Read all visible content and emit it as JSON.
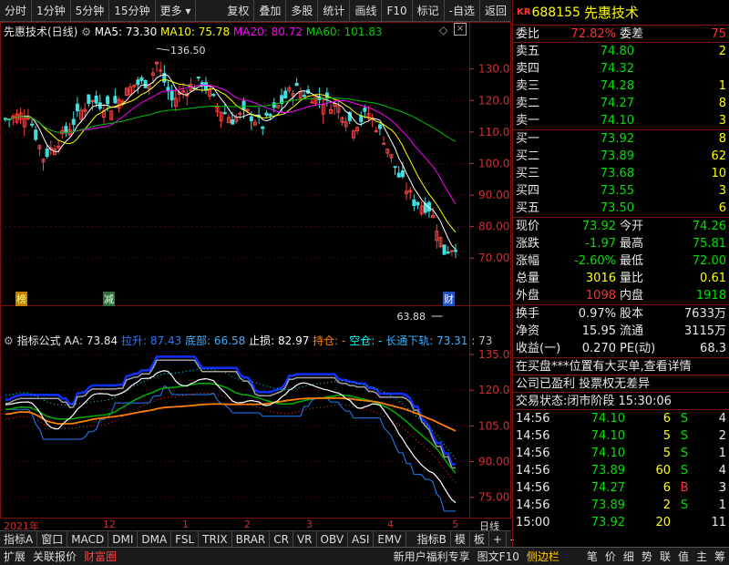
{
  "toolbar": {
    "left_items": [
      "分时",
      "1分钟",
      "5分钟",
      "15分钟",
      "更多"
    ],
    "right_items": [
      "复权",
      "叠加",
      "多股",
      "统计",
      "画线",
      "F10",
      "标记",
      "-自选",
      "返回"
    ]
  },
  "main_chart": {
    "title": "先惠技术(日线)",
    "ma": [
      {
        "label": "MA5: 73.30",
        "color": "#ffffff"
      },
      {
        "label": "MA10: 75.78",
        "color": "#ffff00"
      },
      {
        "label": "MA20: 80.72",
        "color": "#ff00ff"
      },
      {
        "label": "MA60: 101.83",
        "color": "#00d000"
      }
    ],
    "high_label": "136.50",
    "low_label": "63.88",
    "y_ticks": [
      "130.0",
      "120.0",
      "110.0",
      "100.0",
      "90.00",
      "80.00",
      "70.00"
    ],
    "tag_bang": "榜",
    "tag_jian": "减",
    "tag_cai": "财"
  },
  "indicator": {
    "name": "指标公式",
    "aa": "AA: 73.84",
    "items": [
      {
        "text": "拉升: 87.43",
        "color": "#2a7bff"
      },
      {
        "text": "底部: 66.58",
        "color": "#40b0ff"
      },
      {
        "text": "止损: 82.97",
        "color": "#ffffff"
      },
      {
        "text": "持仓: -",
        "color": "#ff8000"
      },
      {
        "text": "空仓: -",
        "color": "#00ffff"
      },
      {
        "text": "长通下轨: 73.31",
        "color": "#40b0ff"
      },
      {
        "text": ": 73",
        "color": "#c0c0c0"
      }
    ],
    "y_ticks": [
      "135.0",
      "120.0",
      "105.0",
      "90.00",
      "75.00"
    ]
  },
  "time_axis": {
    "labels": [
      "2021年",
      "12",
      "1",
      "2",
      "3",
      "4",
      "5"
    ],
    "right": "日线"
  },
  "bottom_tabs": [
    "指标A",
    "窗口",
    "MACD",
    "DMI",
    "DMA",
    "FSL",
    "TRIX",
    "BRAR",
    "CR",
    "VR",
    "OBV",
    "ASI",
    "EMV",
    "",
    "指标B",
    "模",
    "板",
    "+",
    "-"
  ],
  "status_bar": {
    "left": [
      "扩展",
      "关联报价",
      "财富圈"
    ],
    "middle": [
      "新用户福利专享",
      "图文F10",
      "侧边栏"
    ],
    "right": [
      "笔",
      "价",
      "细",
      "势",
      "联",
      "值",
      "主",
      "筹"
    ]
  },
  "quote": {
    "kr": "KR",
    "code": "688155",
    "name": "先惠技术",
    "weibi_label": "委比",
    "weibi": "72.82%",
    "weicha_label": "委差",
    "weicha": "75",
    "asks": [
      {
        "label": "卖五",
        "price": "74.80",
        "vol": "2"
      },
      {
        "label": "卖四",
        "price": "74.32",
        "vol": ""
      },
      {
        "label": "卖三",
        "price": "74.28",
        "vol": "1"
      },
      {
        "label": "卖二",
        "price": "74.27",
        "vol": "8"
      },
      {
        "label": "卖一",
        "price": "74.10",
        "vol": "3"
      }
    ],
    "bids": [
      {
        "label": "买一",
        "price": "73.92",
        "vol": "8"
      },
      {
        "label": "买二",
        "price": "73.89",
        "vol": "62"
      },
      {
        "label": "买三",
        "price": "73.68",
        "vol": "10"
      },
      {
        "label": "买四",
        "price": "73.55",
        "vol": "3"
      },
      {
        "label": "买五",
        "price": "73.50",
        "vol": "6"
      }
    ],
    "stats": [
      {
        "l1": "现价",
        "v1": "73.92",
        "c1": "green",
        "l2": "今开",
        "v2": "74.26",
        "c2": "green"
      },
      {
        "l1": "涨跌",
        "v1": "-1.97",
        "c1": "green",
        "l2": "最高",
        "v2": "75.81",
        "c2": "green"
      },
      {
        "l1": "涨幅",
        "v1": "-2.60%",
        "c1": "green",
        "l2": "最低",
        "v2": "72.00",
        "c2": "green"
      },
      {
        "l1": "总量",
        "v1": "3016",
        "c1": "yellow",
        "l2": "量比",
        "v2": "0.61",
        "c2": "yellow"
      },
      {
        "l1": "外盘",
        "v1": "1098",
        "c1": "red",
        "l2": "内盘",
        "v2": "1918",
        "c2": "green"
      }
    ],
    "stats2": [
      {
        "l1": "换手",
        "v1": "0.97%",
        "l2": "股本",
        "v2": "7633万"
      },
      {
        "l1": "净资",
        "v1": "15.95",
        "l2": "流通",
        "v2": "3115万"
      },
      {
        "l1": "收益(一)",
        "v1": "0.270",
        "l2": "PE(动)",
        "v2": "68.3"
      }
    ],
    "notice1": "在买盘***位置有大买单,查看详情",
    "notice2": "公司已盈利 投票权无差异",
    "trade_state_label": "交易状态:",
    "trade_state": "闭市阶段 15:30:06",
    "ticks": [
      {
        "t": "14:56",
        "p": "74.10",
        "pc": "green",
        "v": "6",
        "bs": "S",
        "bc": "green",
        "n": "4"
      },
      {
        "t": "14:56",
        "p": "74.10",
        "pc": "green",
        "v": "5",
        "bs": "S",
        "bc": "green",
        "n": "2"
      },
      {
        "t": "14:56",
        "p": "74.10",
        "pc": "green",
        "v": "5",
        "bs": "S",
        "bc": "green",
        "n": "1"
      },
      {
        "t": "14:56",
        "p": "73.89",
        "pc": "green",
        "v": "60",
        "bs": "S",
        "bc": "green",
        "n": "4"
      },
      {
        "t": "14:56",
        "p": "74.27",
        "pc": "green",
        "v": "6",
        "bs": "B",
        "bc": "red",
        "n": "3"
      },
      {
        "t": "14:56",
        "p": "73.89",
        "pc": "green",
        "v": "2",
        "bs": "S",
        "bc": "green",
        "n": "1"
      },
      {
        "t": "15:00",
        "p": "73.92",
        "pc": "green",
        "v": "20",
        "bs": "",
        "bc": "gray",
        "n": "11"
      }
    ]
  }
}
